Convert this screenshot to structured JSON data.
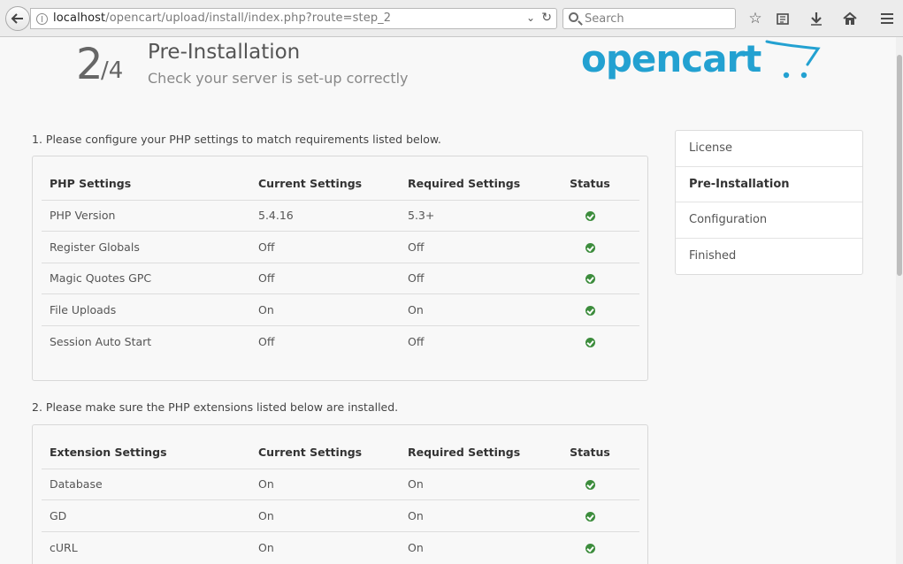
{
  "browser": {
    "url_host": "localhost",
    "url_path": "/opencart/upload/install/index.php?route=step_2",
    "search_placeholder": "Search"
  },
  "header": {
    "step_current": "2",
    "step_total": "/4",
    "title": "Pre-Installation",
    "subtitle": "Check your server is set-up correctly",
    "logo_text": "opencart"
  },
  "php_section": {
    "label": "1. Please configure your PHP settings to match requirements listed below.",
    "headers": [
      "PHP Settings",
      "Current Settings",
      "Required Settings",
      "Status"
    ],
    "rows": [
      {
        "name": "PHP Version",
        "current": "5.4.16",
        "required": "5.3+",
        "status": "ok"
      },
      {
        "name": "Register Globals",
        "current": "Off",
        "required": "Off",
        "status": "ok"
      },
      {
        "name": "Magic Quotes GPC",
        "current": "Off",
        "required": "Off",
        "status": "ok"
      },
      {
        "name": "File Uploads",
        "current": "On",
        "required": "On",
        "status": "ok"
      },
      {
        "name": "Session Auto Start",
        "current": "Off",
        "required": "Off",
        "status": "ok"
      }
    ]
  },
  "ext_section": {
    "label": "2. Please make sure the PHP extensions listed below are installed.",
    "headers": [
      "Extension Settings",
      "Current Settings",
      "Required Settings",
      "Status"
    ],
    "rows": [
      {
        "name": "Database",
        "current": "On",
        "required": "On",
        "status": "ok"
      },
      {
        "name": "GD",
        "current": "On",
        "required": "On",
        "status": "ok"
      },
      {
        "name": "cURL",
        "current": "On",
        "required": "On",
        "status": "ok"
      }
    ]
  },
  "steps": [
    {
      "label": "License",
      "active": false
    },
    {
      "label": "Pre-Installation",
      "active": true
    },
    {
      "label": "Configuration",
      "active": false
    },
    {
      "label": "Finished",
      "active": false
    }
  ],
  "colors": {
    "logo_blue": "#23a1d1",
    "check_green": "#3c8c3c"
  }
}
